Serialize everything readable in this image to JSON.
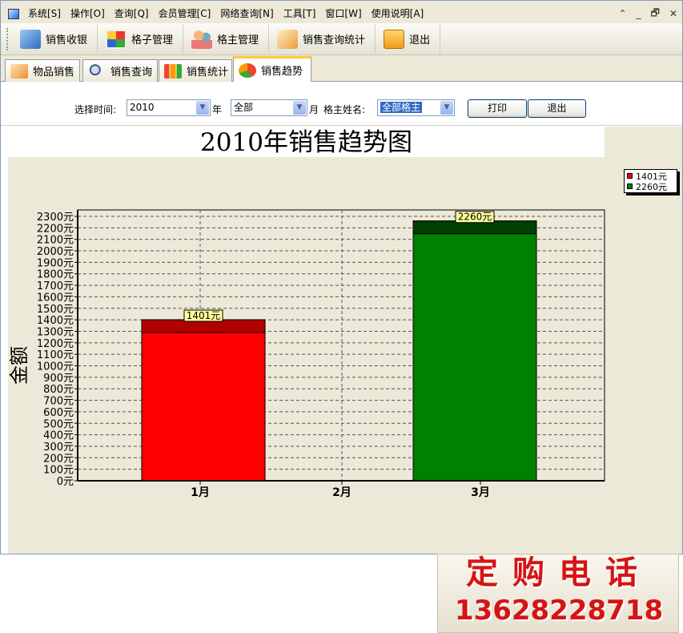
{
  "menu": [
    "系统[S]",
    "操作[O]",
    "查询[Q]",
    "会员管理[C]",
    "网络查询[N]",
    "工具[T]",
    "窗口[W]",
    "使用说明[A]"
  ],
  "window_controls": [
    "⌃",
    "_",
    "🗗",
    "✕"
  ],
  "toolbar": [
    "销售收银",
    "格子管理",
    "格主管理",
    "销售查询统计",
    "退出"
  ],
  "tabs": [
    "物品销售",
    "销售查询",
    "销售统计",
    "销售趋势"
  ],
  "filter": {
    "time_label": "选择时间:",
    "year_value": "2010",
    "year_suffix": "年",
    "month_value": "全部",
    "month_suffix": "月",
    "owner_label": "格主姓名:",
    "owner_value": "全部格主",
    "print_label": "打印",
    "exit_label": "退出"
  },
  "chart_data": {
    "type": "bar",
    "title": "2010年销售趋势图",
    "ylabel": "金额",
    "xlabel": "",
    "categories": [
      "1月",
      "2月",
      "3月"
    ],
    "series": [
      {
        "name": "1401元",
        "values": [
          1401,
          0,
          0
        ],
        "color": "#ff0000"
      },
      {
        "name": "2260元",
        "values": [
          0,
          0,
          2260
        ],
        "color": "#008000"
      }
    ],
    "bar_labels": [
      "1401元",
      "",
      "2260元"
    ],
    "ylim": [
      0,
      2300
    ],
    "y_tick_step": 100,
    "y_tick_suffix": "元",
    "grid": true,
    "legend_position": "top-right"
  },
  "ad": {
    "title": "定购电话",
    "phone": "13628228718"
  }
}
